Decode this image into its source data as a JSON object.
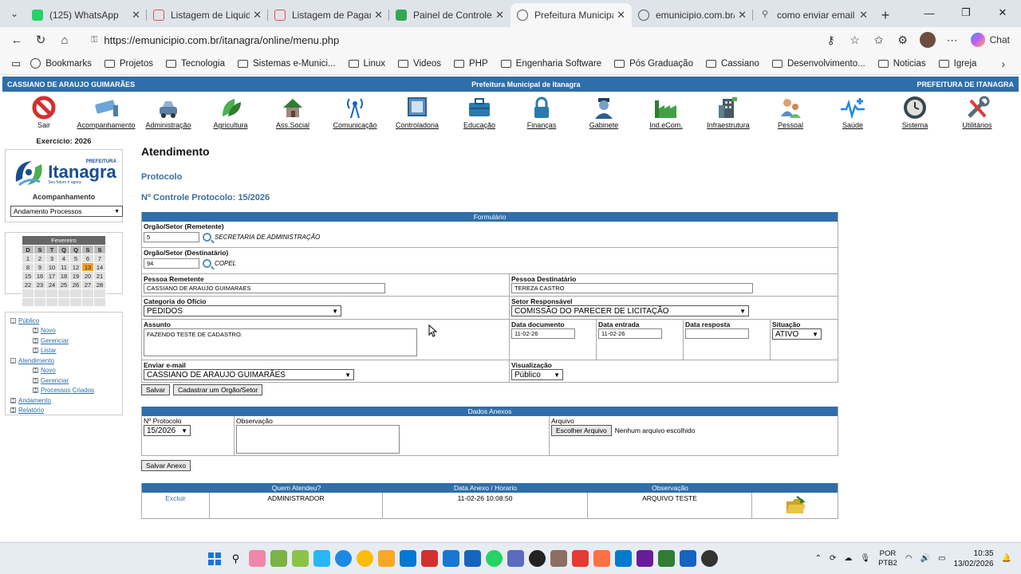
{
  "browser": {
    "tabs": [
      {
        "label": "(125) WhatsApp",
        "color": "#25d366"
      },
      {
        "label": "Listagem de Liquidação",
        "color": "#d9534f"
      },
      {
        "label": "Listagem de Pagamento",
        "color": "#d9534f"
      },
      {
        "label": "Painel de Controle Emu",
        "color": "#34a853"
      },
      {
        "label": "Prefeitura Municipal de",
        "color": "#888888"
      },
      {
        "label": "emunicipio.com.br/pms",
        "color": "#888888"
      },
      {
        "label": "como enviar email usan",
        "color": "#888888"
      }
    ],
    "url": "https://emunicipio.com.br/itanagra/online/menu.php",
    "chat_label": "Chat",
    "bookmarks": [
      "Bookmarks",
      "Projetos",
      "Tecnologia",
      "Sistemas e-Munici...",
      "Linux",
      "Videos",
      "PHP",
      "Engenharia Software",
      "Pós Graduação",
      "Cassiano",
      "Desenvolvimento...",
      "Noticias",
      "Igreja"
    ]
  },
  "header": {
    "user": "CASSIANO DE ARAUJO GUIMARÃES",
    "title": "Prefeitura Municipal de Itanagra",
    "entity": "PREFEITURA DE ITANAGRA"
  },
  "modules": [
    {
      "label": "Sair",
      "icon": "exit-icon"
    },
    {
      "label": "Acompanhamento",
      "icon": "cctv-icon"
    },
    {
      "label": "Administração",
      "icon": "car-icon"
    },
    {
      "label": "Agricultura",
      "icon": "leaf-icon"
    },
    {
      "label": "Ass.Social",
      "icon": "house-icon"
    },
    {
      "label": "Comunicação",
      "icon": "antenna-icon"
    },
    {
      "label": "Controladoria",
      "icon": "monitor-icon"
    },
    {
      "label": "Educação",
      "icon": "briefcase-icon"
    },
    {
      "label": "Finanças",
      "icon": "lock-icon"
    },
    {
      "label": "Gabinete",
      "icon": "person-icon"
    },
    {
      "label": "Ind.eCom.",
      "icon": "factory-icon"
    },
    {
      "label": "Infraestrutura",
      "icon": "building-icon"
    },
    {
      "label": "Pessoal",
      "icon": "people-icon"
    },
    {
      "label": "Saúde",
      "icon": "heartbeat-icon"
    },
    {
      "label": "Sistema",
      "icon": "clock-icon"
    },
    {
      "label": "Utilitários",
      "icon": "tools-icon"
    }
  ],
  "sidebar": {
    "exercicio": "Exercício: 2026",
    "logo_top": "PREFEITURA",
    "logo_name": "Itanagra",
    "logo_slogan": "Seu futuro é agora",
    "section_label": "Acompanhamento",
    "select_value": "Andamento Processos",
    "calendar": {
      "month": "Fevereiro",
      "days": [
        "D",
        "S",
        "T",
        "Q",
        "Q",
        "S",
        "S"
      ],
      "weeks": [
        [
          "1",
          "2",
          "3",
          "4",
          "5",
          "6",
          "7"
        ],
        [
          "8",
          "9",
          "10",
          "11",
          "12",
          "13",
          "14"
        ],
        [
          "15",
          "16",
          "17",
          "18",
          "19",
          "20",
          "21"
        ],
        [
          "22",
          "23",
          "24",
          "25",
          "26",
          "27",
          "28"
        ],
        [
          "",
          "",
          "",
          "",
          "",
          "",
          ""
        ],
        [
          "",
          "",
          "",
          "",
          "",
          "",
          ""
        ]
      ],
      "today": "13"
    },
    "tree": [
      {
        "label": "Público",
        "level": 0,
        "sign": "-"
      },
      {
        "label": "Novo",
        "level": 1,
        "sign": "+"
      },
      {
        "label": "Gerenciar",
        "level": 1,
        "sign": "+"
      },
      {
        "label": "Listar",
        "level": 1,
        "sign": "+"
      },
      {
        "label": "Atendimento",
        "level": 0,
        "sign": "-"
      },
      {
        "label": "Novo",
        "level": 1,
        "sign": "+"
      },
      {
        "label": "Gerenciar",
        "level": 1,
        "sign": "+"
      },
      {
        "label": "Processos Criados",
        "level": 1,
        "sign": "+"
      },
      {
        "label": "Andamento",
        "level": 0,
        "sign": "+"
      },
      {
        "label": "Relatório",
        "level": 0,
        "sign": "+"
      }
    ]
  },
  "page": {
    "title": "Atendimento",
    "subtitle": "Protocolo",
    "control": "Nº Controle Protocolo: 15/2026"
  },
  "form": {
    "header": "Formulário",
    "remetente_label": "Orgão/Setor (Remetente)",
    "remetente_code": "5",
    "remetente_name": "SECRETARIA DE ADMINISTRAÇÃO",
    "destinatario_label": "Orgão/Setor (Destinatário)",
    "destinatario_code": "94",
    "destinatario_name": "COPEL",
    "pessoa_rem_label": "Pessoa Remetente",
    "pessoa_rem_value": "CASSIANO DE ARAUJO GUIMARAES",
    "pessoa_dest_label": "Pessoa Destinatário",
    "pessoa_dest_value": "TEREZA CASTRO",
    "categoria_label": "Categoria do Ofício",
    "categoria_value": "PEDIDOS",
    "setor_label": "Setor Responsável",
    "setor_value": "COMISSÃO DO PARECER DE LICITAÇÃO",
    "assunto_label": "Assunto",
    "assunto_value": "FAZENDO TESTE DE CADASTRO.",
    "data_doc_label": "Data documento",
    "data_doc_value": "11-02-26",
    "data_ent_label": "Data entrada",
    "data_ent_value": "11-02-26",
    "data_resp_label": "Data resposta",
    "data_resp_value": "",
    "situacao_label": "Situação",
    "situacao_value": "ATIVO",
    "email_label": "Enviar e-mail",
    "email_value": "CASSIANO DE ARAUJO GUIMARÃES",
    "visual_label": "Visualização",
    "visual_value": "Público",
    "save_label": "Salvar",
    "register_label": "Cadastrar um Orgão/Setor"
  },
  "anexos": {
    "header": "Dados Anexos",
    "protocolo_label": "Nº Protocolo",
    "protocolo_value": "15/2026",
    "obs_label": "Observação",
    "arquivo_label": "Arquivo",
    "choose_label": "Escolher Arquivo",
    "no_file": "Nenhum arquivo escolhido",
    "save_label": "Salvar Anexo"
  },
  "table": {
    "headers": [
      "",
      "Quem Atendeu?",
      "Data Anexo / Horario",
      "Observação",
      ""
    ],
    "rows": [
      {
        "action": "Excluir",
        "who": "ADMINISTRADOR",
        "date": "11-02-26 10:08:50",
        "obs": "ARQUIVO TESTE"
      }
    ]
  },
  "taskbar": {
    "lang1": "POR",
    "lang2": "PTB2",
    "time": "10:35",
    "date": "13/02/2026"
  },
  "colors": {
    "accent": "#2f6ea9",
    "today": "#f0a030"
  }
}
